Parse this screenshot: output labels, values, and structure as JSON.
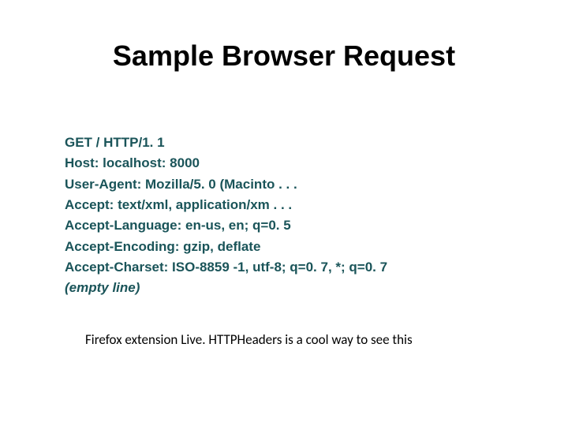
{
  "title": "Sample Browser Request",
  "request": {
    "line0": "GET / HTTP/1. 1",
    "line1": "Host: localhost: 8000",
    "line2": "User-Agent: Mozilla/5. 0 (Macinto . . .",
    "line3": "Accept: text/xml, application/xm . . .",
    "line4": "Accept-Language: en-us, en; q=0. 5",
    "line5": "Accept-Encoding: gzip, deflate",
    "line6": "Accept-Charset: ISO-8859 -1, utf-8; q=0. 7, *; q=0. 7",
    "line7": "(empty line)"
  },
  "footnote": "Firefox extension Live. HTTPHeaders is a cool way to see this"
}
